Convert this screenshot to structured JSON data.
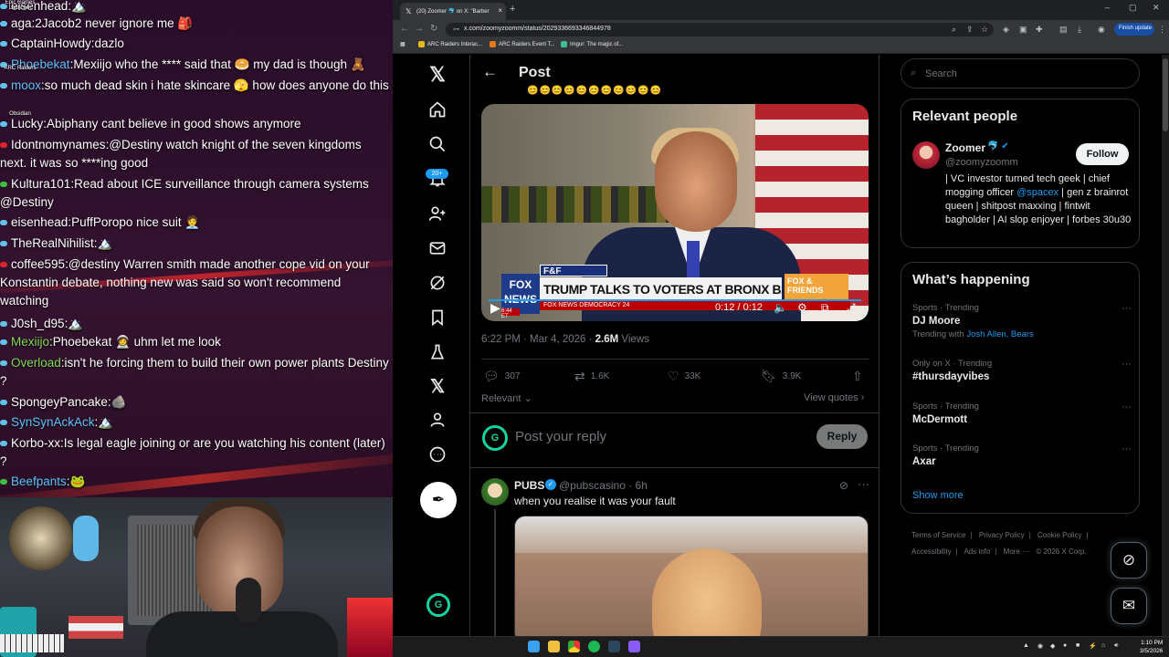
{
  "chat": {
    "messages": [
      {
        "user": "eisenhead",
        "text": ":🏔️",
        "color": "#ffffff",
        "badge": "#62c3e8"
      },
      {
        "user": "aga",
        "text": ":2Jacob2 never ignore me 🎒",
        "color": "#ffffff",
        "badge": "#62c3e8"
      },
      {
        "user": "CaptainHowdy",
        "text": ":dazlo",
        "color": "#ffffff",
        "badge": "#62c3e8"
      },
      {
        "user": "Phoebekat",
        "text": ":Mexiijo who the **** said that 🥯 my dad is though 🧸",
        "color": "#5fc3ff",
        "badge": "#62c3e8"
      },
      {
        "user": "moox",
        "text": ":so much dead skin i hate skincare 🫣 how does anyone do this",
        "color": "#5fc3ff",
        "badge": "#62c3e8"
      },
      {
        "user": "Lucky",
        "text": ":Abiphany cant believe in good shows anymore",
        "color": "#ffffff",
        "badge": "#62c3e8"
      },
      {
        "user": "Idontnomynames",
        "text": ":@Destiny watch knight of the seven kingdoms next. it was so ****ing good",
        "color": "#ffffff",
        "badge": "#e0242e"
      },
      {
        "user": "Kultura101",
        "text": ":Read about ICE surveillance through camera systems @Destiny",
        "color": "#ffffff",
        "badge": "#3fbf3f"
      },
      {
        "user": "eisenhead",
        "text": ":PuffPoropo nice suit 🧑‍💼",
        "color": "#ffffff",
        "badge": "#62c3e8"
      },
      {
        "user": "TheRealNihilist",
        "text": ":🏔️",
        "color": "#ffffff",
        "badge": "#62c3e8"
      },
      {
        "user": "coffee595",
        "text": ":@destiny Warren smith made another cope vid on your Konstantin debate, nothing new was said so won't recommend watching",
        "color": "#ffffff",
        "badge": "#e0242e"
      },
      {
        "user": "J0sh_d95",
        "text": ":🏔️",
        "color": "#ffffff",
        "badge": "#62c3e8"
      },
      {
        "user": "Mexiijo",
        "text": ":Phoebekat 🧑‍🚀 uhm let me look",
        "color": "#7ed957",
        "badge": "#62c3e8"
      },
      {
        "user": "Overload",
        "text": ":isn't he forcing them to build their own power plants Destiny ?",
        "color": "#7ed957",
        "badge": "#62c3e8"
      },
      {
        "user": "SpongeyPancake",
        "text": ":🪨",
        "color": "#ffffff",
        "badge": "#62c3e8"
      },
      {
        "user": "SynSynAckAck",
        "text": ":🏔️",
        "color": "#5fc3ff",
        "badge": "#62c3e8"
      },
      {
        "user": "Korbo-xx",
        "text": ":Is legal eagle joining or are you watching his content (later) ?",
        "color": "#ffffff",
        "badge": "#62c3e8"
      },
      {
        "user": "Beefpants",
        "text": ":🐸",
        "color": "#5fc3ff",
        "badge": "#3fbf3f"
      }
    ],
    "desktop_icons": [
      "Epic Games Launcher",
      "ARC Raiders",
      "Obsidian"
    ]
  },
  "browser": {
    "tab_title": "(20) Zoomer 🐬 on X: \"Barber",
    "url": "x.com/zoomyzoomm/status/2029336693346844978",
    "update_label": "Finish update",
    "bookmarks": [
      {
        "label": "ARC Raiders Interac...",
        "color": "#e8b818"
      },
      {
        "label": "ARC Raiders Event T...",
        "color": "#e87a18"
      },
      {
        "label": "Imgur: The magic of...",
        "color": "#3fbf8f"
      }
    ]
  },
  "x": {
    "notif_badge": "20+",
    "header": {
      "title": "Post"
    },
    "emoji_row": "😊😊😊😊😊😊😊😊😊😊😊",
    "video": {
      "tag": "F&F EXCLUSIVE",
      "headline": "TRUMP TALKS TO VOTERS AT BRONX BARBERSHOP",
      "logo": "FOX NEWS",
      "show": "FOX & FRIENDS",
      "ticker": "FOX NEWS  DEMOCRACY 24",
      "clock": "6:44 ET",
      "timecode": "0:12 / 0:12",
      "progress": 1.0
    },
    "meta": {
      "date": "6:22 PM · Mar 4, 2026 · ",
      "views_count": "2.6M",
      "views_label": " Views"
    },
    "actions": {
      "replies": "307",
      "reposts": "1.6K",
      "likes": "33K",
      "bookmarks": "3.9K"
    },
    "sort_label": "Relevant",
    "view_quotes": "View quotes",
    "reply": {
      "placeholder": "Post your reply",
      "button": "Reply"
    },
    "reply_post": {
      "name": "PUBS",
      "handle": "@pubscasino · 6h",
      "text": "when you realise it was your fault"
    },
    "search_placeholder": "Search",
    "relevant_people": {
      "title": "Relevant people",
      "name": "Zoomer",
      "badges": "🐬 ✔",
      "handle": "@zoomyzoomm",
      "follow": "Follow",
      "bio_1": "| VC investor turned tech geek | chief mogging officer ",
      "bio_link": "@spacex",
      "bio_2": " | gen z brainrot queen | shitpost maxxing | fintwit bagholder | AI slop enjoyer | forbes 30u30"
    },
    "whats_happening": {
      "title": "What’s happening",
      "trends": [
        {
          "context": "Sports · Trending",
          "name": "DJ Moore",
          "with_label": "Trending with ",
          "with_links": "Josh Allen, Bears"
        },
        {
          "context": "Only on X · Trending",
          "name": "#thursdayvibes"
        },
        {
          "context": "Sports · Trending",
          "name": "McDermott"
        },
        {
          "context": "Sports · Trending",
          "name": "Axar"
        }
      ],
      "show_more": "Show more"
    },
    "footer": {
      "terms": "Terms of Service",
      "privacy": "Privacy Policy",
      "cookie": "Cookie Policy",
      "accessibility": "Accessibility",
      "ads": "Ads info",
      "more": "More ···",
      "copyright": "© 2026 X Corp."
    }
  },
  "taskbar": {
    "time": "1:10 PM",
    "date": "3/5/2026"
  }
}
